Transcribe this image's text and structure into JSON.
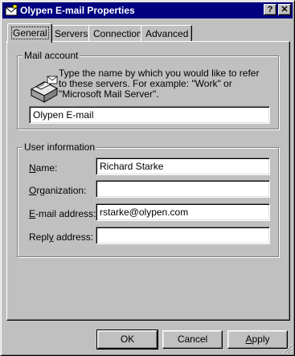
{
  "window": {
    "title": "Olypen E-mail Properties",
    "help_glyph": "?",
    "close_glyph": "✕"
  },
  "tabs": [
    {
      "label": "General",
      "active": true
    },
    {
      "label": "Servers",
      "active": false
    },
    {
      "label": "Connection",
      "active": false
    },
    {
      "label": "Advanced",
      "active": false
    }
  ],
  "mail_account": {
    "group_label": "Mail account",
    "icon": "mail-server-icon",
    "description": "Type the name by which you would like to refer to these servers.  For example: \"Work\" or \"Microsoft Mail Server\".",
    "account_name": "Olypen E-mail"
  },
  "user_information": {
    "group_label": "User information",
    "name_label": "Name:",
    "name_value": "Richard Starke",
    "organization_label": "Organization:",
    "organization_value": "",
    "email_label": "E-mail address:",
    "email_value": "rstarke@olypen.com",
    "reply_label": "Reply address:",
    "reply_value": ""
  },
  "buttons": {
    "ok": "OK",
    "cancel": "Cancel",
    "apply": "Apply"
  }
}
